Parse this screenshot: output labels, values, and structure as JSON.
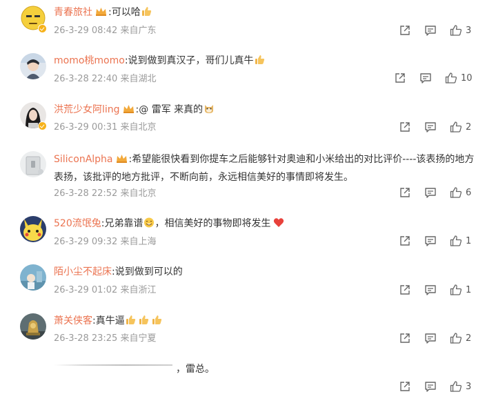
{
  "comments": [
    {
      "username": "青春旅社",
      "separator": ":",
      "text": "可以哈",
      "meta": "26-3-29 08:42 来自广东",
      "likes": "3",
      "emojis": [
        "thumbs-up"
      ]
    },
    {
      "username": "momo桃momo",
      "separator": ":",
      "text": "说到做到真汉子，哥们儿真牛",
      "meta": "26-3-28 22:40 来自湖北",
      "likes": "10",
      "emojis": [
        "thumbs-up"
      ]
    },
    {
      "username": "洪荒少女阿ling",
      "separator": ":",
      "text": "@ 雷军 来真的",
      "meta": "26-3-29 00:31 来自北京",
      "likes": "2",
      "emojis": [
        "doge"
      ]
    },
    {
      "username": "SiliconAlpha",
      "separator": ":",
      "text": "希望能很快看到你提车之后能够针对奥迪和小米给出的对比评价----该表扬的地方表扬，该批评的地方批评，不断向前，永远相信美好的事情即将发生。",
      "meta": "26-3-28 22:52 来自北京",
      "likes": "6",
      "emojis": []
    },
    {
      "username": "520流氓兔",
      "separator": ":",
      "text": "兄弟靠谱",
      "text2": "，相信美好的事物即将发生",
      "meta": "26-3-29 09:32 来自上海",
      "likes": "1",
      "emojis": [
        "grin",
        "heart"
      ]
    },
    {
      "username": "陌小尘不起床",
      "separator": ":",
      "text": "说到做到可以的",
      "meta": "26-3-29 01:02 来自浙江",
      "likes": "1",
      "emojis": []
    },
    {
      "username": "萧关侠客",
      "separator": ":",
      "text": "真牛逼",
      "meta": "26-3-28 23:25 来自宁夏",
      "likes": "2",
      "emojis": [
        "thumbs-up",
        "thumbs-up",
        "thumbs-up"
      ]
    },
    {
      "username": "",
      "text": "，雷总。",
      "meta": "",
      "likes": "3",
      "emojis": []
    }
  ],
  "icons": {
    "share": "share-icon",
    "comment": "comment-icon",
    "like": "like-icon"
  },
  "colors": {
    "username": "#eb7350",
    "meta": "#9a9a9a",
    "text": "#333333",
    "badge": "#f6b21b"
  }
}
